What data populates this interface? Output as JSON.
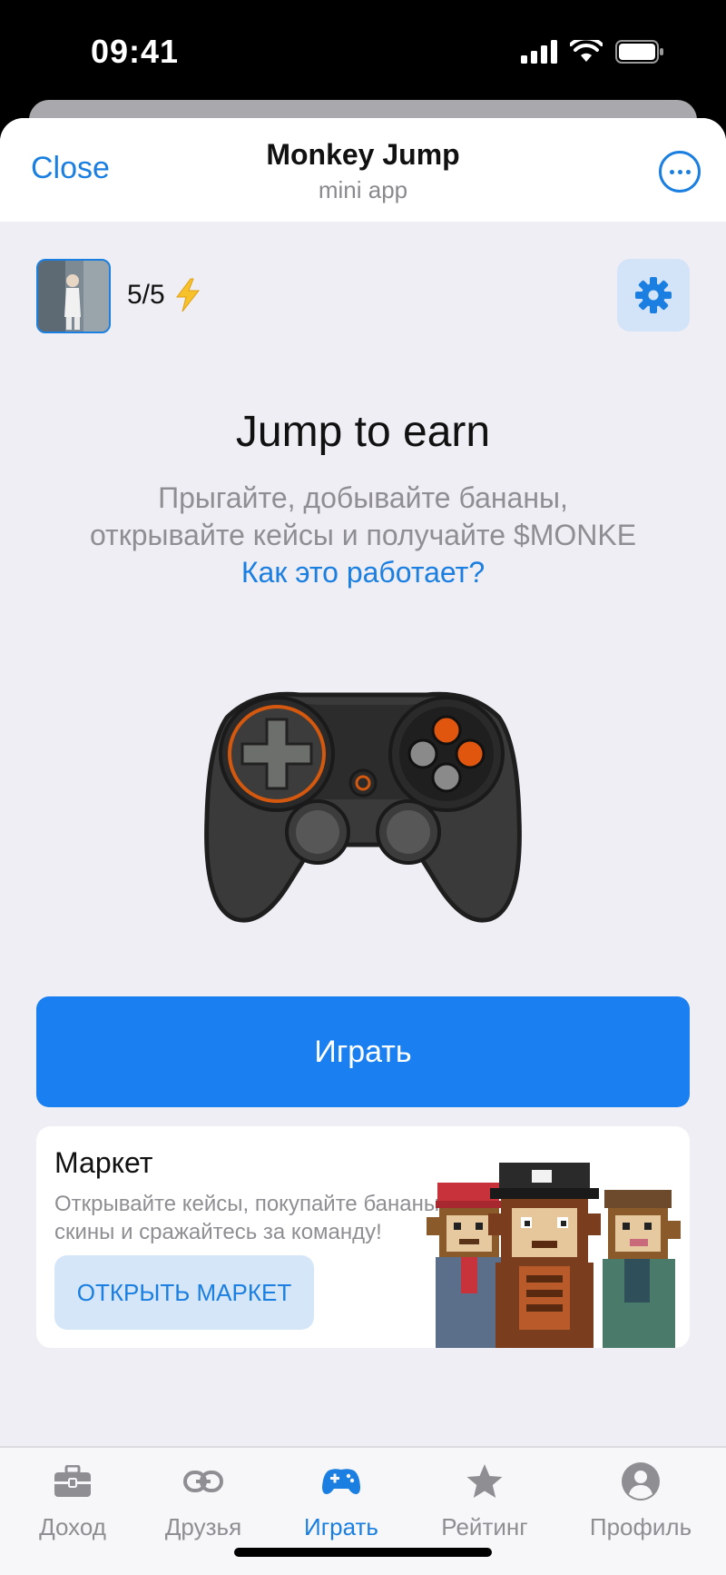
{
  "status_bar": {
    "time": "09:41"
  },
  "nav": {
    "close_label": "Close",
    "title": "Monkey Jump",
    "subtitle": "mini app"
  },
  "header": {
    "energy": "5/5"
  },
  "hero": {
    "title": "Jump to earn",
    "description_line1": "Прыгайте, добывайте бананы,",
    "description_line2": "открывайте кейсы и получайте $MONKE",
    "link": "Как это работает?"
  },
  "play_button": {
    "label": "Играть"
  },
  "market": {
    "title": "Маркет",
    "description_line1": "Открывайте кейсы, покупайте бананы,",
    "description_line2": "скины и сражайтесь за команду!",
    "button_label": "ОТКРЫТЬ МАРКЕТ"
  },
  "tabs": [
    {
      "label": "Доход",
      "icon": "briefcase-icon"
    },
    {
      "label": "Друзья",
      "icon": "link-icon"
    },
    {
      "label": "Играть",
      "icon": "gamepad-icon",
      "active": true
    },
    {
      "label": "Рейтинг",
      "icon": "star-icon"
    },
    {
      "label": "Профиль",
      "icon": "person-icon"
    }
  ],
  "colors": {
    "accent": "#1a7ff0",
    "background": "#efeef4"
  }
}
